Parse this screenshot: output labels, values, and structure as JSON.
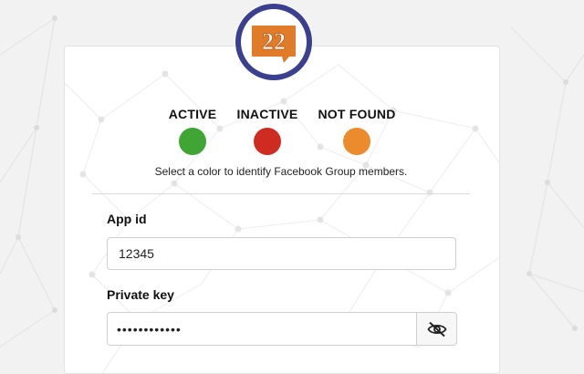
{
  "logo": {
    "text": "22",
    "ring_color": "#3b3f8f",
    "badge_color": "#e07b2a"
  },
  "statuses": [
    {
      "label": "ACTIVE",
      "color": "#3fa535"
    },
    {
      "label": "INACTIVE",
      "color": "#cf2b20"
    },
    {
      "label": "NOT FOUND",
      "color": "#ec8a2e"
    }
  ],
  "hint": "Select a color to identify Facebook Group members.",
  "fields": {
    "app_id": {
      "label": "App id",
      "value": "12345"
    },
    "private_key": {
      "label": "Private key",
      "value": "••••••••••••",
      "toggle_icon": "eye-slash-icon"
    }
  }
}
